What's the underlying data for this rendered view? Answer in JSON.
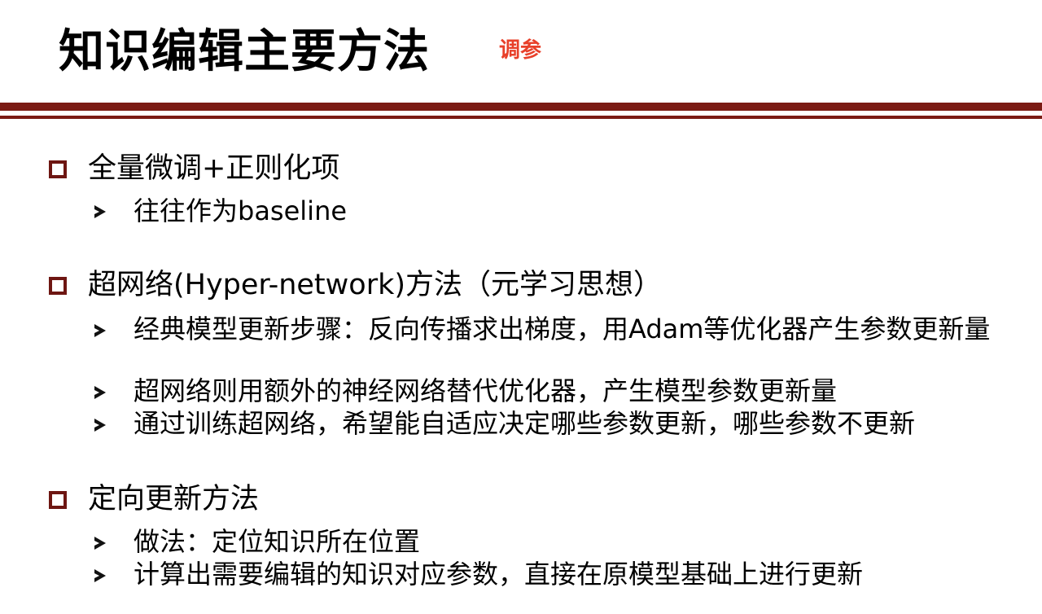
{
  "slide": {
    "title": "知识编辑主要方法",
    "tag": "调参"
  },
  "sections": [
    {
      "heading": "全量微调+正则化项",
      "items": [
        "往往作为baseline"
      ]
    },
    {
      "heading": "超网络(Hyper-network)方法（元学习思想）",
      "items": [
        "经典模型更新步骤：反向传播求出梯度，用Adam等优化器产生参数更新量",
        "超网络则用额外的神经网络替代优化器，产生模型参数更新量",
        "通过训练超网络，希望能自适应决定哪些参数更新，哪些参数不更新"
      ]
    },
    {
      "heading": "定向更新方法",
      "items": [
        "做法：定位知识所在位置",
        "计算出需要编辑的知识对应参数，直接在原模型基础上进行更新"
      ]
    }
  ],
  "colors": {
    "rule": "#7b1b14",
    "tag": "#e8402a",
    "bullet_box": "#6e1612"
  },
  "icons": {
    "level1": "hollow-square",
    "level2": "arrowhead"
  }
}
